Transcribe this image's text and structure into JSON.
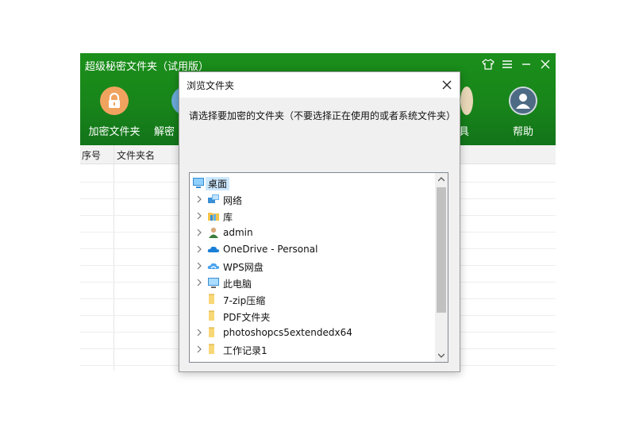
{
  "app": {
    "title": "超级秘密文件夹（试用版）",
    "toolbar": {
      "encrypt_label": "加密文件夹",
      "decrypt_label_partial": "解密",
      "hidden_tool_label_partial": "具",
      "help_label": "帮助"
    },
    "table": {
      "columns": [
        "序号",
        "文件夹名"
      ]
    },
    "colors": {
      "header_green": "#18851a",
      "encrypt_icon": "#f0a35e",
      "help_icon": "#4d6b84"
    }
  },
  "dialog": {
    "title": "浏览文件夹",
    "instruction": "请选择要加密的文件夹（不要选择正在使用的或者系统文件夹）",
    "tree": {
      "root": {
        "label": "桌面",
        "icon": "desktop-icon"
      },
      "items": [
        {
          "label": "网络",
          "icon": "network-icon",
          "expandable": true
        },
        {
          "label": "库",
          "icon": "library-icon",
          "expandable": true
        },
        {
          "label": "admin",
          "icon": "user-icon",
          "expandable": true
        },
        {
          "label": "OneDrive - Personal",
          "icon": "onedrive-icon",
          "expandable": true
        },
        {
          "label": "WPS网盘",
          "icon": "wps-cloud-icon",
          "expandable": true
        },
        {
          "label": "此电脑",
          "icon": "computer-icon",
          "expandable": true
        },
        {
          "label": "7-zip压缩",
          "icon": "folder-icon",
          "expandable": false
        },
        {
          "label": "PDF文件夹",
          "icon": "folder-icon",
          "expandable": false
        },
        {
          "label": "photoshopcs5extendedx64",
          "icon": "folder-icon",
          "expandable": true
        },
        {
          "label": "工作记录1",
          "icon": "folder-icon",
          "expandable": true
        }
      ]
    }
  }
}
